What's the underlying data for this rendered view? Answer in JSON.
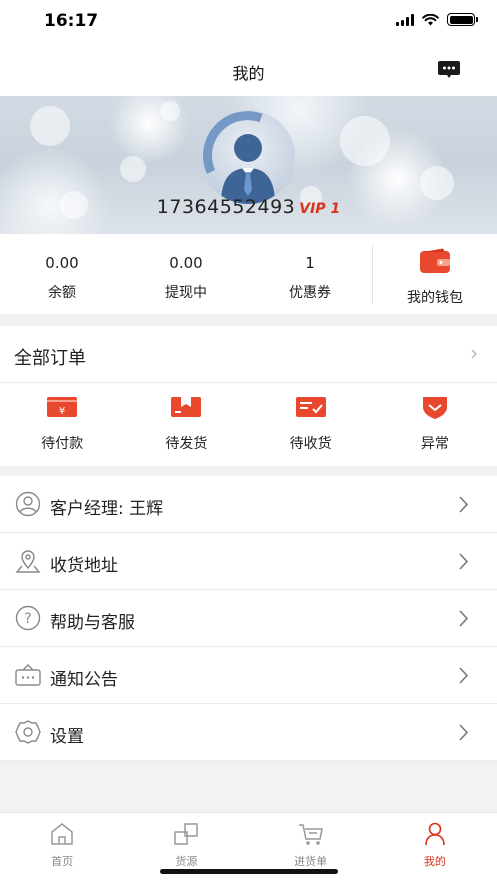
{
  "status": {
    "time": "16:17"
  },
  "nav": {
    "title": "我的",
    "message_icon": "chat-bubble-icon"
  },
  "profile": {
    "phone": "17364552493",
    "vip": "VIP 1",
    "avatar_icon": "user-avatar-icon"
  },
  "stats": [
    {
      "value": "0.00",
      "label": "余额"
    },
    {
      "value": "0.00",
      "label": "提现中"
    },
    {
      "value": "1",
      "label": "优惠券"
    }
  ],
  "wallet": {
    "label": "我的钱包",
    "icon": "wallet-icon"
  },
  "orders": {
    "title": "全部订单",
    "items": [
      {
        "label": "待付款",
        "icon": "pending-payment-icon"
      },
      {
        "label": "待发货",
        "icon": "pending-shipment-icon"
      },
      {
        "label": "待收货",
        "icon": "pending-receipt-icon"
      },
      {
        "label": "异常",
        "icon": "exception-icon"
      }
    ]
  },
  "menu": [
    {
      "label": "客户经理: 王辉",
      "icon": "account-manager-icon"
    },
    {
      "label": "收货地址",
      "icon": "location-icon"
    },
    {
      "label": "帮助与客服",
      "icon": "help-icon"
    },
    {
      "label": "通知公告",
      "icon": "notice-icon"
    },
    {
      "label": "设置",
      "icon": "settings-icon"
    }
  ],
  "tabs": [
    {
      "label": "首页",
      "icon": "home-icon",
      "active": false
    },
    {
      "label": "货源",
      "icon": "source-icon",
      "active": false
    },
    {
      "label": "进货单",
      "icon": "cart-icon",
      "active": false
    },
    {
      "label": "我的",
      "icon": "profile-icon",
      "active": true
    }
  ],
  "colors": {
    "accent": "#d9331b",
    "accent_light": "#e8492e",
    "background": "#f2f2f2"
  }
}
